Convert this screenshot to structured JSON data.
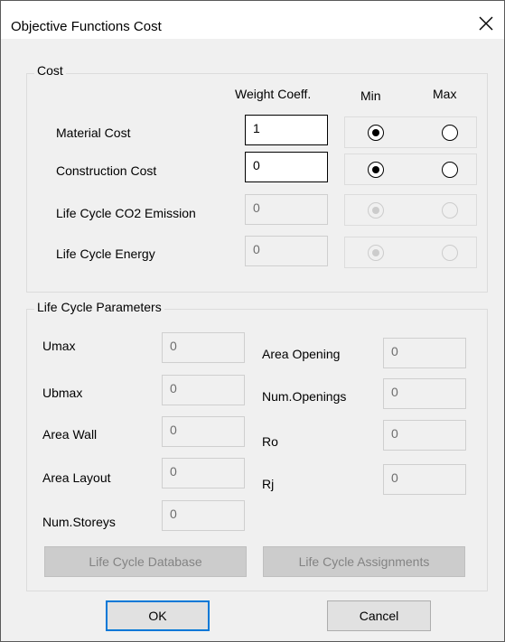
{
  "window": {
    "title": "Objective Functions Cost"
  },
  "cost": {
    "group_label": "Cost",
    "headers": {
      "weight": "Weight Coeff.",
      "min": "Min",
      "max": "Max"
    },
    "rows": [
      {
        "label": "Material Cost",
        "value": "1",
        "enabled": true,
        "selected": "min"
      },
      {
        "label": "Construction Cost",
        "value": "0",
        "enabled": true,
        "selected": "min"
      },
      {
        "label": "Life Cycle CO2 Emission",
        "value": "0",
        "enabled": false,
        "selected": "min"
      },
      {
        "label": "Life Cycle Energy",
        "value": "0",
        "enabled": false,
        "selected": "min"
      }
    ]
  },
  "life_cycle": {
    "group_label": "Life Cycle Parameters",
    "left": [
      {
        "label": "Umax",
        "value": "0"
      },
      {
        "label": "Ubmax",
        "value": "0"
      },
      {
        "label": "Area Wall",
        "value": "0"
      },
      {
        "label": "Area Layout",
        "value": "0"
      },
      {
        "label": "Num.Storeys",
        "value": "0"
      }
    ],
    "right": [
      {
        "label": "Area Opening",
        "value": "0"
      },
      {
        "label": "Num.Openings",
        "value": "0"
      },
      {
        "label": "Ro",
        "value": "0"
      },
      {
        "label": "Rj",
        "value": "0"
      }
    ],
    "database_button": "Life Cycle Database",
    "assignments_button": "Life Cycle Assignments"
  },
  "buttons": {
    "ok": "OK",
    "cancel": "Cancel"
  }
}
